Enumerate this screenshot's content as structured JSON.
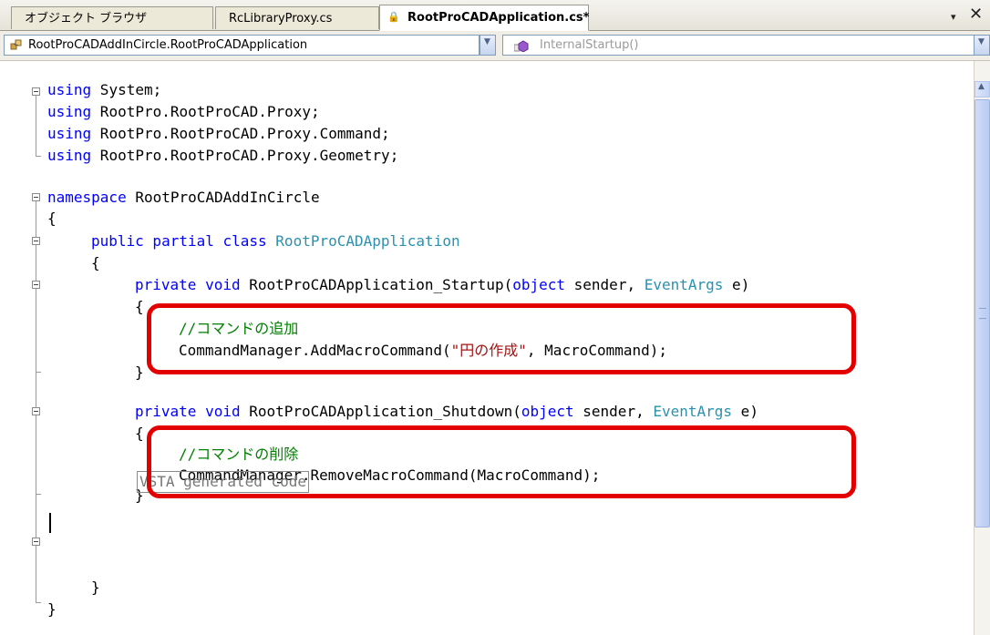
{
  "tabs": [
    {
      "label": "オブジェクト ブラウザ"
    },
    {
      "label": "RcLibraryProxy.cs"
    },
    {
      "label": "RootProCADApplication.cs*"
    }
  ],
  "tab_controls": {
    "dropdown": "▾",
    "close": "✕"
  },
  "nav": {
    "type_combo": "RootProCADAddInCircle.RootProCADApplication",
    "member_combo": "InternalStartup()"
  },
  "code": {
    "l1": "using System;",
    "l2": "using RootPro.RootProCAD.Proxy;",
    "l3": "using RootPro.RootProCAD.Proxy.Command;",
    "l4": "using RootPro.RootProCAD.Proxy.Geometry;",
    "ns": "namespace RootProCADAddInCircle",
    "class_decl": "public partial class RootProCADApplication",
    "startup_sig": "private void RootProCADApplication_Startup(object sender, EventArgs e)",
    "comment_add": "//コマンドの追加",
    "add_call_a": "CommandManager.AddMacroCommand(",
    "add_str": "\"円の作成\"",
    "add_call_b": ", MacroCommand);",
    "shutdown_sig": "private void RootProCADApplication_Shutdown(object sender, EventArgs e)",
    "comment_remove": "//コマンドの削除",
    "remove_call": "CommandManager.RemoveMacroCommand(MacroCommand);",
    "region": "VSTA generated code",
    "kw_using": "using",
    "kw_namespace": "namespace",
    "open_brace": "{",
    "close_brace": "}"
  },
  "colors": {
    "keyword": "#0000ff",
    "type": "#2b91af",
    "comment": "#008000",
    "string": "#a31515",
    "highlight": "#e30000"
  }
}
